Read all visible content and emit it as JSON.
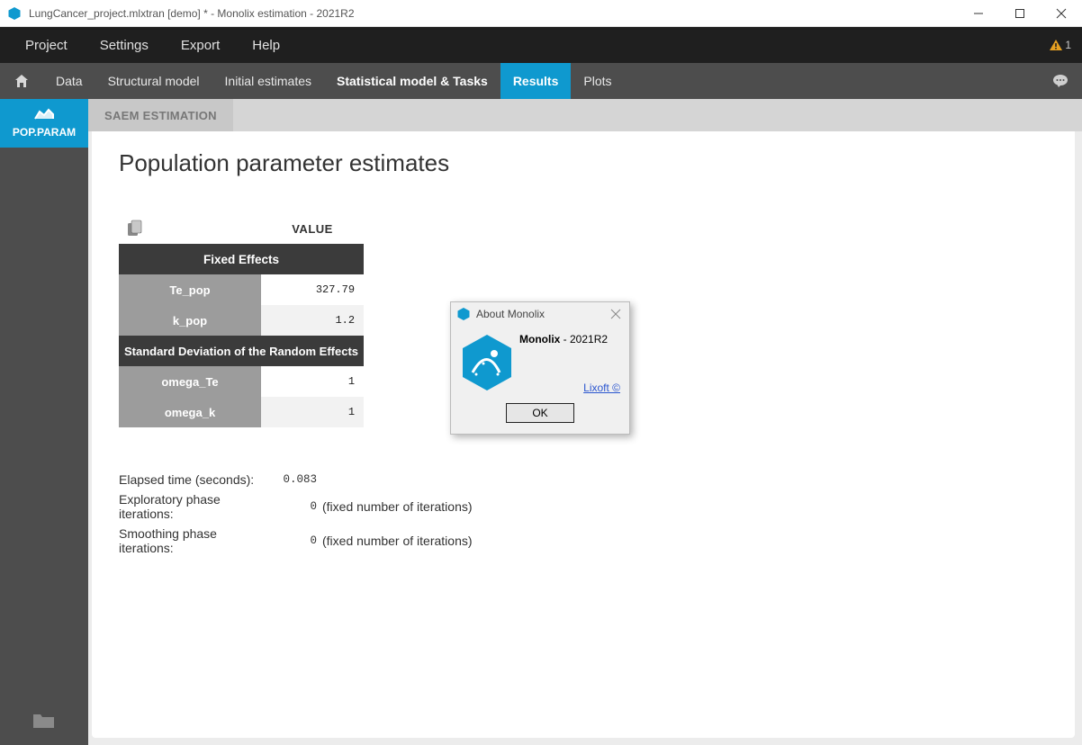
{
  "window": {
    "title": "LungCancer_project.mlxtran [demo] * - Monolix estimation - 2021R2"
  },
  "menubar": {
    "items": [
      "Project",
      "Settings",
      "Export",
      "Help"
    ],
    "warning_count": "1"
  },
  "tabs": {
    "items": [
      "Data",
      "Structural model",
      "Initial estimates",
      "Statistical model & Tasks",
      "Results",
      "Plots"
    ]
  },
  "sidebar": {
    "pop_param_label": "POP.PARAM"
  },
  "subtabs": {
    "saem": "SAEM ESTIMATION"
  },
  "content": {
    "title": "Population parameter estimates",
    "value_header": "VALUE",
    "section_fixed": "Fixed Effects",
    "section_random": "Standard Deviation of the Random Effects",
    "rows_fixed": [
      {
        "label": "Te_pop",
        "value": "327.79"
      },
      {
        "label": "k_pop",
        "value": "1.2"
      }
    ],
    "rows_random": [
      {
        "label": "omega_Te",
        "value": "1"
      },
      {
        "label": "omega_k",
        "value": "1"
      }
    ]
  },
  "stats": {
    "elapsed_label": "Elapsed time (seconds):",
    "elapsed_value": "0.083",
    "exploratory_label": "Exploratory phase iterations:",
    "exploratory_value": "0",
    "exploratory_note": "(fixed number of iterations)",
    "smoothing_label": "Smoothing phase iterations:",
    "smoothing_value": "0",
    "smoothing_note": "(fixed number of iterations)"
  },
  "about": {
    "title": "About Monolix",
    "product": "Monolix",
    "version_sep": " - ",
    "version": "2021R2",
    "link": "Lixoft ©",
    "ok": "OK"
  }
}
